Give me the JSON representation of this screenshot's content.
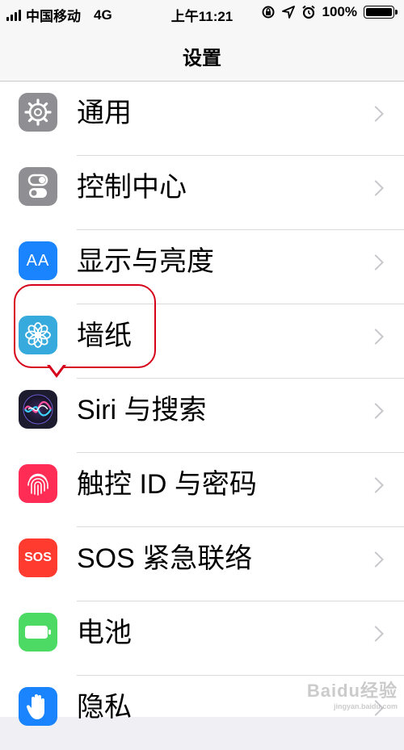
{
  "status_bar": {
    "carrier": "中国移动",
    "network": "4G",
    "time": "上午11:21",
    "battery_percent": "100%",
    "battery_level": 1.0,
    "icons": [
      "signal-icon",
      "orientation-lock-icon",
      "location-icon",
      "alarm-icon",
      "battery-icon"
    ]
  },
  "nav": {
    "title": "设置"
  },
  "settings": [
    {
      "label": "通用",
      "icon": "gear-icon",
      "color": "#8e8e93"
    },
    {
      "label": "控制中心",
      "icon": "toggle-switches-icon",
      "color": "#8e8e93"
    },
    {
      "label": "显示与亮度",
      "icon": "text-size-icon",
      "color": "#1a84ff"
    },
    {
      "label": "墙纸",
      "icon": "flower-icon",
      "color": "#36aadc"
    },
    {
      "label": "Siri 与搜索",
      "icon": "siri-icon",
      "color": "#1c1c2e"
    },
    {
      "label": "触控 ID 与密码",
      "icon": "fingerprint-icon",
      "color": "#ff2d55"
    },
    {
      "label": "SOS 紧急联络",
      "icon": "sos-icon",
      "color": "#ff3b30"
    },
    {
      "label": "电池",
      "icon": "battery-setting-icon",
      "color": "#4cd964"
    },
    {
      "label": "隐私",
      "icon": "hand-icon",
      "color": "#1a84ff"
    }
  ],
  "display_icon_text": "AA",
  "sos_icon_text": "SOS",
  "watermark": {
    "text": "Baidu经验",
    "url_text": "jingyan.baidu.com"
  }
}
